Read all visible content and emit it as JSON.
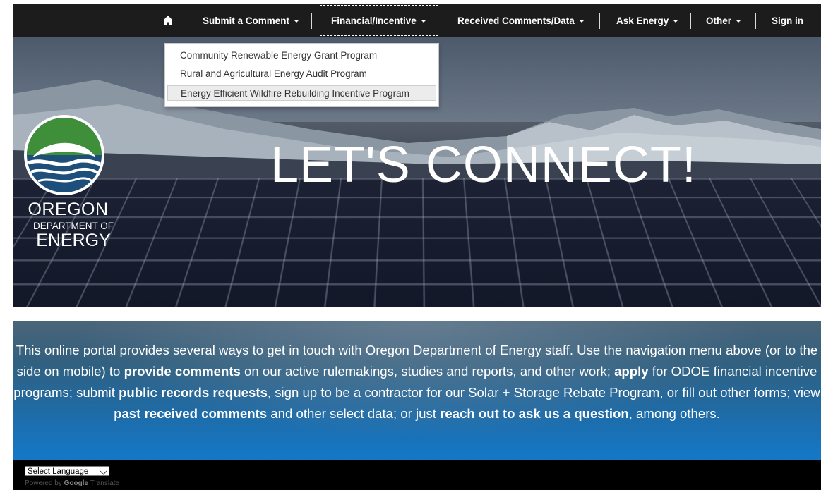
{
  "nav": {
    "home_icon": "home-icon",
    "items": [
      {
        "label": "Submit a Comment"
      },
      {
        "label": "Financial/Incentive"
      },
      {
        "label": "Received Comments/Data"
      },
      {
        "label": "Ask Energy"
      },
      {
        "label": "Other"
      },
      {
        "label": "Sign in"
      }
    ],
    "active": "Financial/Incentive"
  },
  "dropdown": {
    "items": [
      {
        "label": "Community Renewable Energy Grant Program"
      },
      {
        "label": "Rural and Agricultural Energy Audit Program"
      },
      {
        "label": "Energy Efficient Wildfire Rebuilding Incentive Program"
      }
    ],
    "highlighted_index": 2
  },
  "hero": {
    "title": "LET'S CONNECT!",
    "logo": {
      "line1": "OREGON",
      "line2": "DEPARTMENT OF",
      "line3": "ENERGY"
    }
  },
  "info": {
    "t1": "This online portal provides several ways to get in touch with Oregon Department of Energy staff. Use the navigation menu above (or to the side on mobile) to ",
    "b1": "provide comments",
    "t2": " on our active rulemakings, studies and reports, and other work; ",
    "b2": "apply",
    "t3": " for ODOE financial incentive programs; submit ",
    "b3": "public records requests",
    "t4": ", sign up to be a contractor for our Solar + Storage Rebate Program, or fill out other forms; view ",
    "b4": "past received comments",
    "t5": " and other select data; or just ",
    "b5": "reach out to ask us a question",
    "t6": ", among others."
  },
  "footer": {
    "language_select": "Select Language",
    "powered_by": "Powered by",
    "google": "Google",
    "translate": "Translate"
  },
  "colors": {
    "nav_bg": "#1c1c1c",
    "footer_bg": "#000000",
    "info_blue": "#1478c8"
  }
}
